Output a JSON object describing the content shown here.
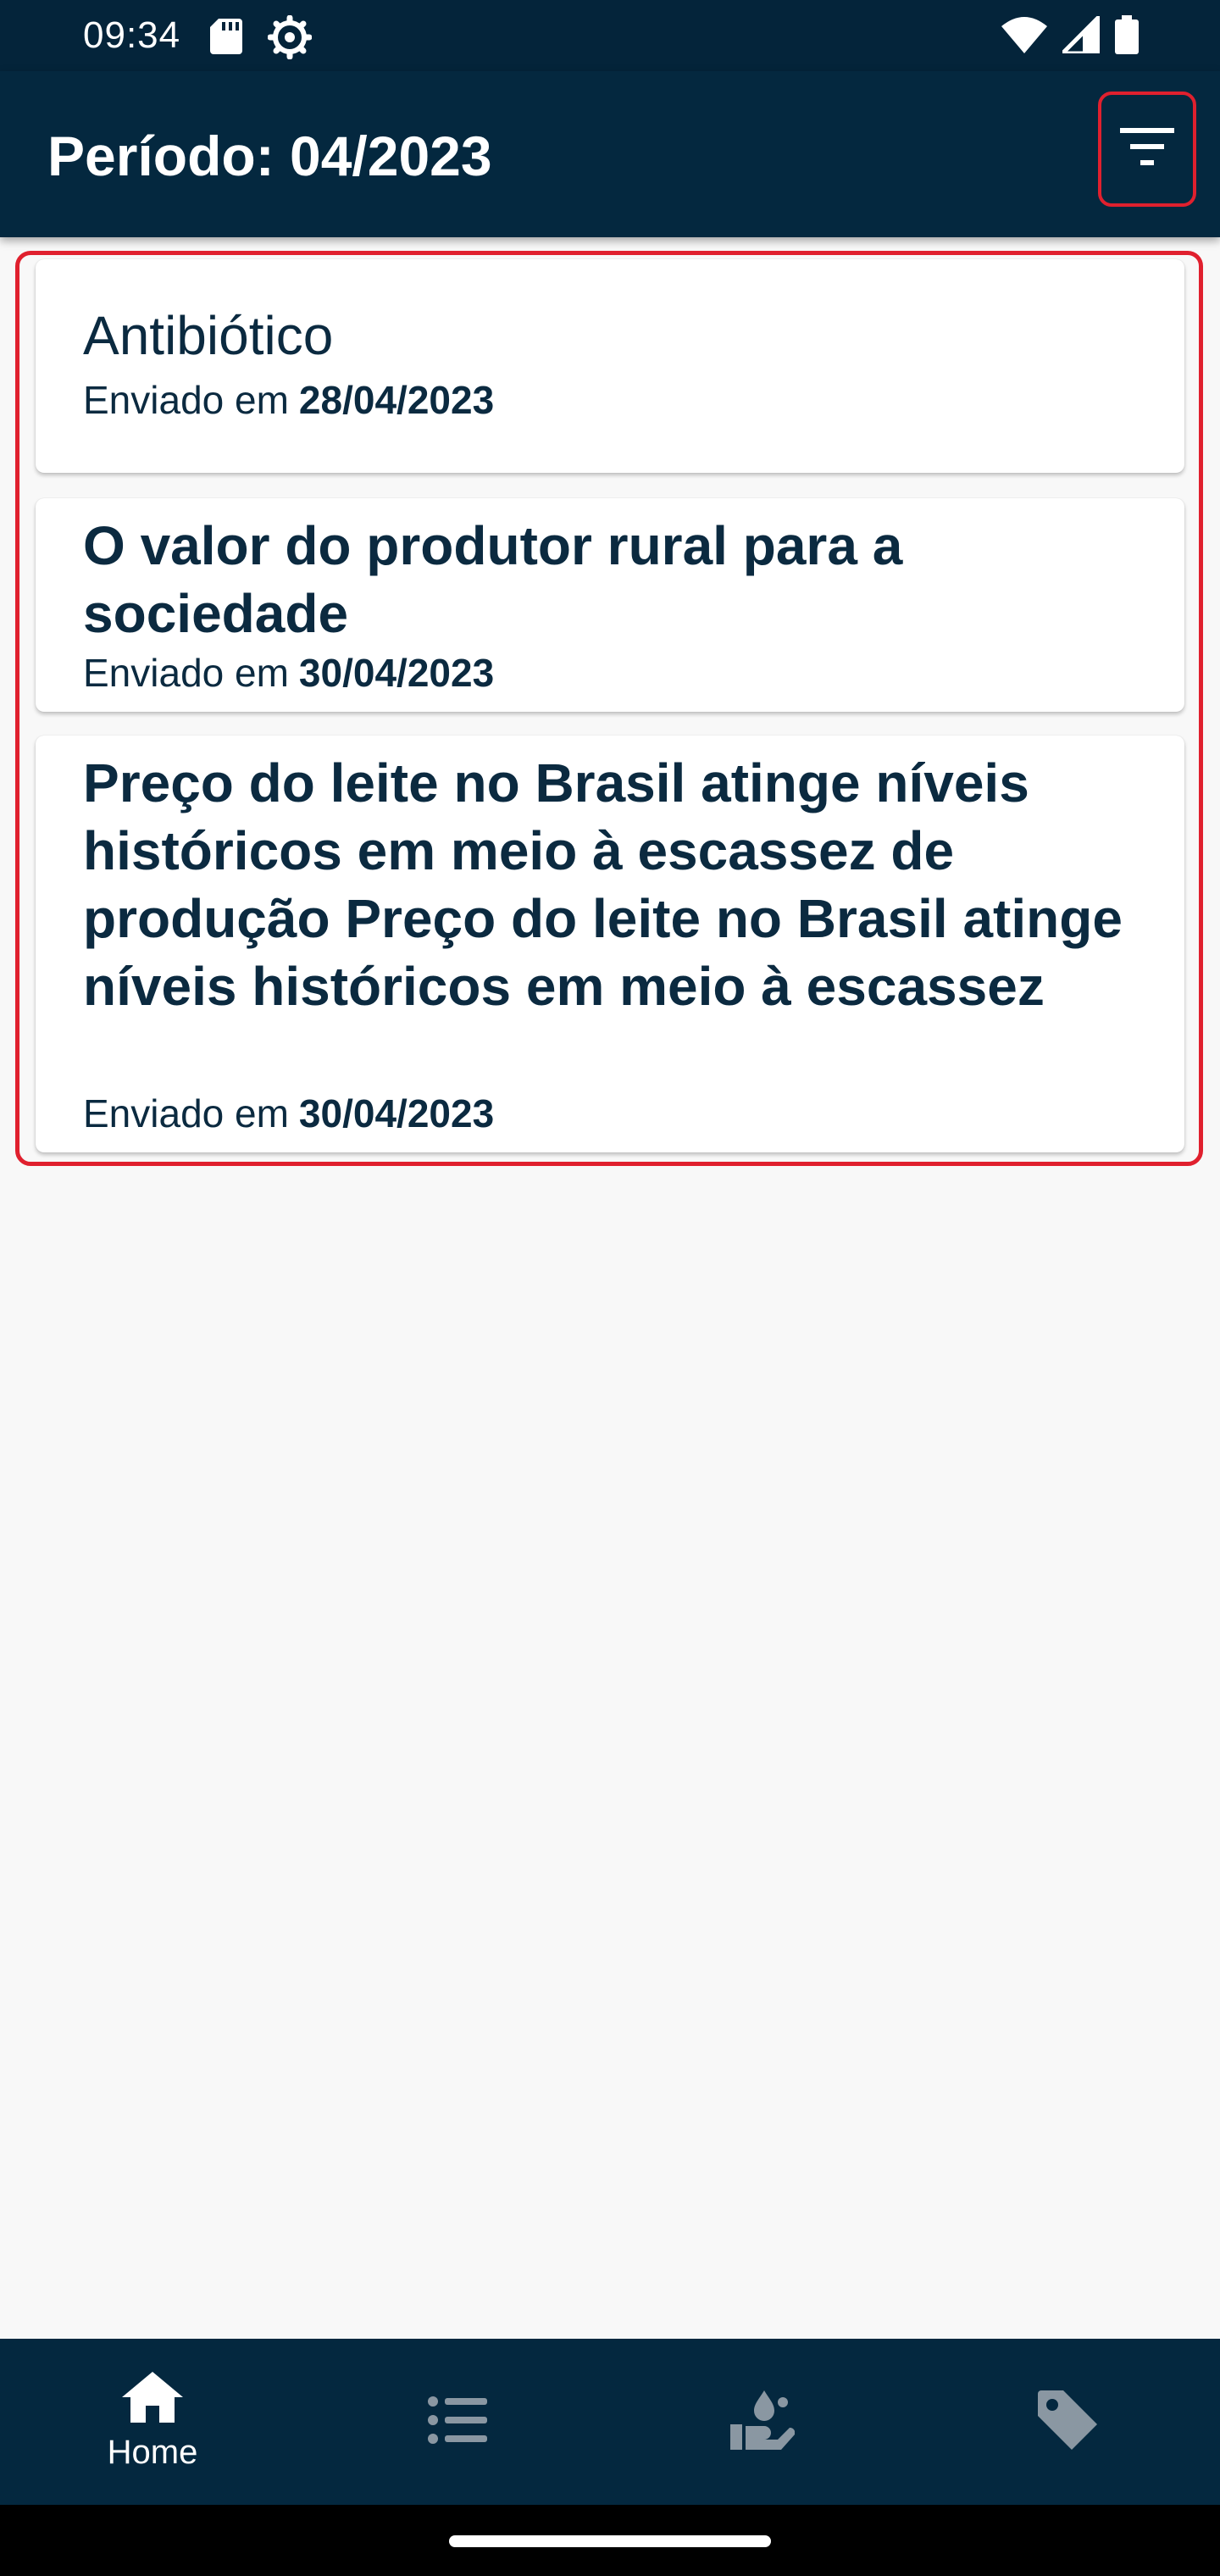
{
  "status_bar": {
    "time": "09:34",
    "icons": [
      "sd-card-icon",
      "settings-gear-icon",
      "wifi-icon",
      "signal-icon",
      "battery-icon"
    ]
  },
  "app_bar": {
    "title": "Período: 04/2023",
    "filter_icon": "filter-icon"
  },
  "messages": [
    {
      "title": "Antibiótico",
      "sent_label": "Enviado em",
      "date": "28/04/2023"
    },
    {
      "title": "O valor do produtor rural para a sociedade",
      "sent_label": "Enviado em",
      "date": "30/04/2023"
    },
    {
      "title": "Preço do leite no Brasil atinge níveis históricos em meio à escassez de produção Preço do leite no Brasil atinge níveis históricos em meio à escassez",
      "sent_label": "Enviado em",
      "date": "30/04/2023"
    }
  ],
  "bottom_nav": {
    "items": [
      {
        "label": "Home",
        "icon": "home-icon",
        "active": true
      },
      {
        "icon": "list-icon"
      },
      {
        "icon": "hand-drop-icon"
      },
      {
        "icon": "tag-icon"
      }
    ]
  },
  "colors": {
    "app_bar": "#04283f",
    "status_bar": "#04243a",
    "text_dark": "#0b2a40",
    "highlight_red": "#e0202e",
    "inactive_icon": "#8a97a2",
    "background": "#f8f8f8"
  }
}
